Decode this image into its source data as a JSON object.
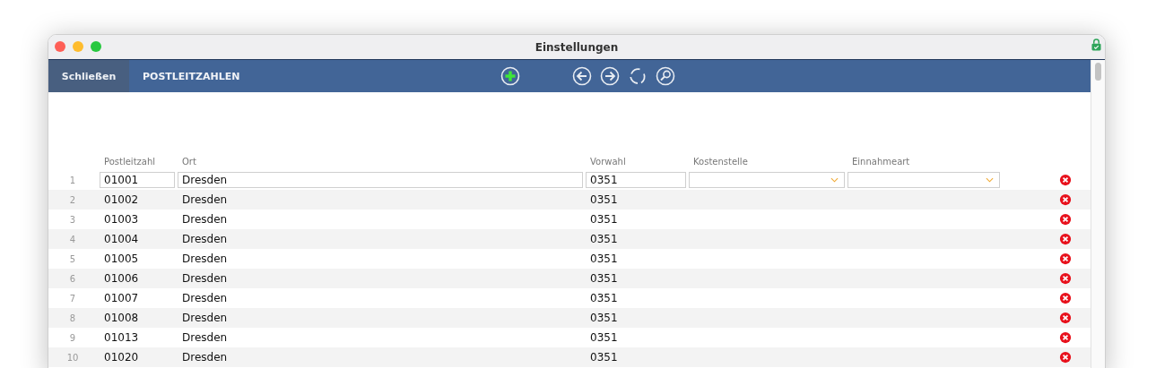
{
  "window": {
    "title": "Einstellungen"
  },
  "toolbar": {
    "close_button": "Schließen",
    "title": "POSTLEITZAHLEN"
  },
  "table": {
    "columns": [
      "Postleitzahl",
      "Ort",
      "Vorwahl",
      "Kostenstelle",
      "Einnahmeart"
    ],
    "rows": [
      {
        "number": "1",
        "postleitzahl": "01001",
        "ort": "Dresden",
        "vorwahl": "0351",
        "selected": true
      },
      {
        "number": "2",
        "postleitzahl": "01002",
        "ort": "Dresden",
        "vorwahl": "0351",
        "selected": false
      },
      {
        "number": "3",
        "postleitzahl": "01003",
        "ort": "Dresden",
        "vorwahl": "0351",
        "selected": false
      },
      {
        "number": "4",
        "postleitzahl": "01004",
        "ort": "Dresden",
        "vorwahl": "0351",
        "selected": false
      },
      {
        "number": "5",
        "postleitzahl": "01005",
        "ort": "Dresden",
        "vorwahl": "0351",
        "selected": false
      },
      {
        "number": "6",
        "postleitzahl": "01006",
        "ort": "Dresden",
        "vorwahl": "0351",
        "selected": false
      },
      {
        "number": "7",
        "postleitzahl": "01007",
        "ort": "Dresden",
        "vorwahl": "0351",
        "selected": false
      },
      {
        "number": "8",
        "postleitzahl": "01008",
        "ort": "Dresden",
        "vorwahl": "0351",
        "selected": false
      },
      {
        "number": "9",
        "postleitzahl": "01013",
        "ort": "Dresden",
        "vorwahl": "0351",
        "selected": false
      },
      {
        "number": "10",
        "postleitzahl": "01020",
        "ort": "Dresden",
        "vorwahl": "0351",
        "selected": false
      }
    ]
  }
}
